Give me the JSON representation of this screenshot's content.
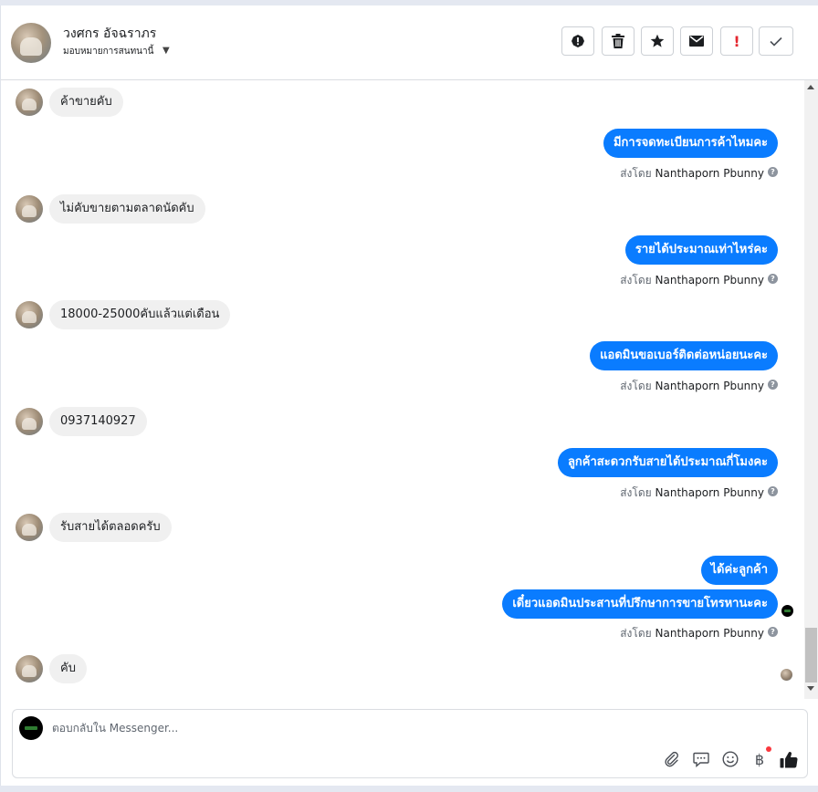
{
  "contact": {
    "name": "วงศกร อัจฉราภร",
    "assign_label": "มอบหมายการสนทนานี้"
  },
  "toolbar": {
    "icons": [
      "alert-icon",
      "trash-icon",
      "star-icon",
      "envelope-icon",
      "exclamation-icon",
      "check-icon"
    ],
    "important_mark": "!",
    "accent_color": "#e4272f"
  },
  "thread": {
    "sent_by_prefix": "ส่งโดย",
    "agent_name": "Nanthaporn Pbunny",
    "info_icon": "?",
    "incoming": [
      "ค้าขายคับ",
      "ไม่คับขายตามตลาดนัดคับ",
      "18000-25000คับแล้วแต่เดือน",
      "0937140927",
      "รับสายได้ตลอดครับ",
      "คับ"
    ],
    "outgoing": [
      "มีการจดทะเบียนการค้าไหมคะ",
      "รายได้ประมาณเท่าไหร่คะ",
      "แอดมินขอเบอร์ติดต่อหน่อยนะคะ",
      "ลูกค้าสะดวกรับสายได้ประมาณกี่โมงคะ",
      "ได้ค่ะลูกค้า",
      "เดี๋ยวแอดมินประสานที่ปรึกษาการขายโทรหานะคะ"
    ],
    "outgoing_color": "#0a7cff",
    "incoming_color": "#f0f0f0"
  },
  "composer": {
    "placeholder": "ตอบกลับใน Messenger...",
    "icons": [
      "paperclip-icon",
      "saved-reply-icon",
      "emoji-icon",
      "baht-payment-icon",
      "thumbs-up-icon"
    ],
    "baht_glyph": "฿"
  }
}
